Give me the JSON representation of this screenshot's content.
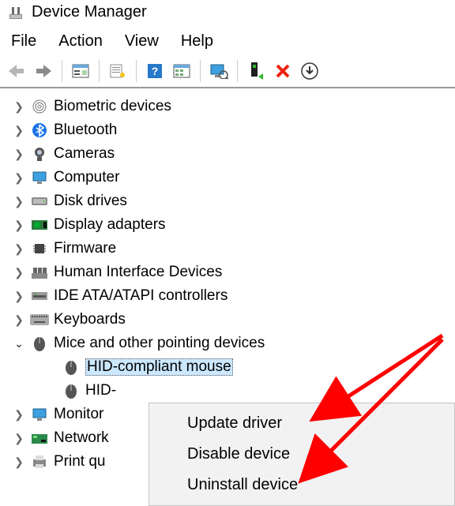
{
  "title": "Device Manager",
  "menu": {
    "file": "File",
    "action": "Action",
    "view": "View",
    "help": "Help"
  },
  "tree": {
    "biometric": "Biometric devices",
    "bluetooth": "Bluetooth",
    "cameras": "Cameras",
    "computer": "Computer",
    "disk": "Disk drives",
    "display": "Display adapters",
    "firmware": "Firmware",
    "hid": "Human Interface Devices",
    "ide": "IDE ATA/ATAPI controllers",
    "keyboards": "Keyboards",
    "mice": "Mice and other pointing devices",
    "mice_child1": "HID-compliant mouse",
    "mice_child2": "HID-",
    "monitors": "Monitor",
    "network": "Network",
    "printq": "Print qu"
  },
  "context": {
    "update": "Update driver",
    "disable": "Disable device",
    "uninstall": "Uninstall device"
  }
}
